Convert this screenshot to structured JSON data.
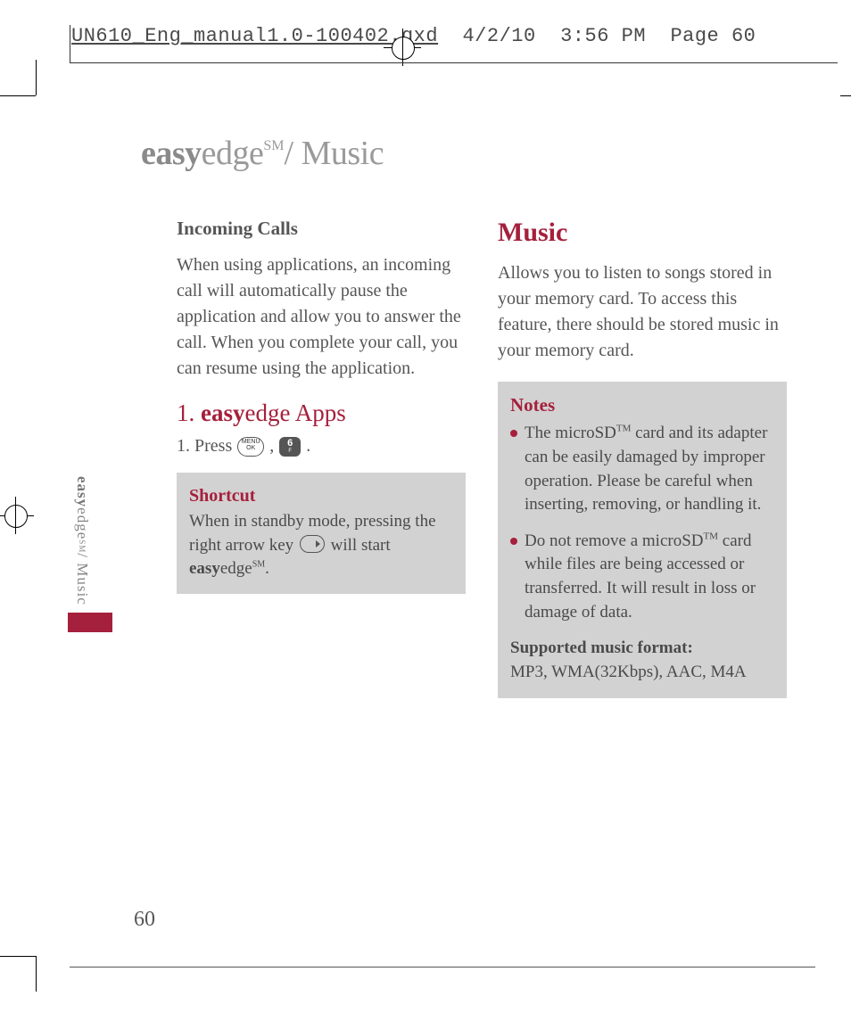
{
  "proof": {
    "filename": "UN610_Eng_manual1.0-100402.qxd",
    "date": "4/2/10",
    "time": "3:56 PM",
    "page_label": "Page 60"
  },
  "main_title": {
    "bold": "easy",
    "rest": "edge",
    "sm": "SM",
    "suffix": "/ Music"
  },
  "side_tab": {
    "bold": "easy",
    "rest": "edge",
    "sm": "SM",
    "suffix": "/ Music"
  },
  "page_number": "60",
  "left_col": {
    "incoming_heading": "Incoming Calls",
    "incoming_para": "When using applications, an incoming call will automatically pause the application and allow you to answer the call. When you complete your call, you can resume using the application.",
    "apps_title_num": "1. ",
    "apps_title_bold": "easy",
    "apps_title_rest": "edge Apps",
    "step_prefix": "1. Press ",
    "step_comma": ", ",
    "step_period": ".",
    "key_ok_top": "MENU",
    "key_ok_bottom": "OK",
    "key_6_top": "6",
    "key_6_bottom": "F",
    "shortcut_title": "Shortcut",
    "shortcut_pre": "When in standby mode, pressing the right arrow key ",
    "shortcut_post_1": " will start ",
    "shortcut_brand_bold": "easy",
    "shortcut_brand_rest": "edge",
    "shortcut_sm": "SM",
    "shortcut_end": "."
  },
  "right_col": {
    "music_heading": "Music",
    "music_para": "Allows you to listen to songs stored in your memory card. To access this feature, there should be stored music in your memory card.",
    "notes_title": "Notes",
    "note1_pre": "The microSD",
    "note1_tm": "TM",
    "note1_post": " card and its adapter can be easily damaged by improper operation. Please be careful when inserting, removing, or handling it.",
    "note2_pre": "Do not remove a microSD",
    "note2_tm": "TM",
    "note2_post": " card while files are being accessed or transferred. It will result in loss or damage of data.",
    "supported_label": "Supported music format:",
    "supported_value": "MP3, WMA(32Kbps), AAC, M4A"
  }
}
